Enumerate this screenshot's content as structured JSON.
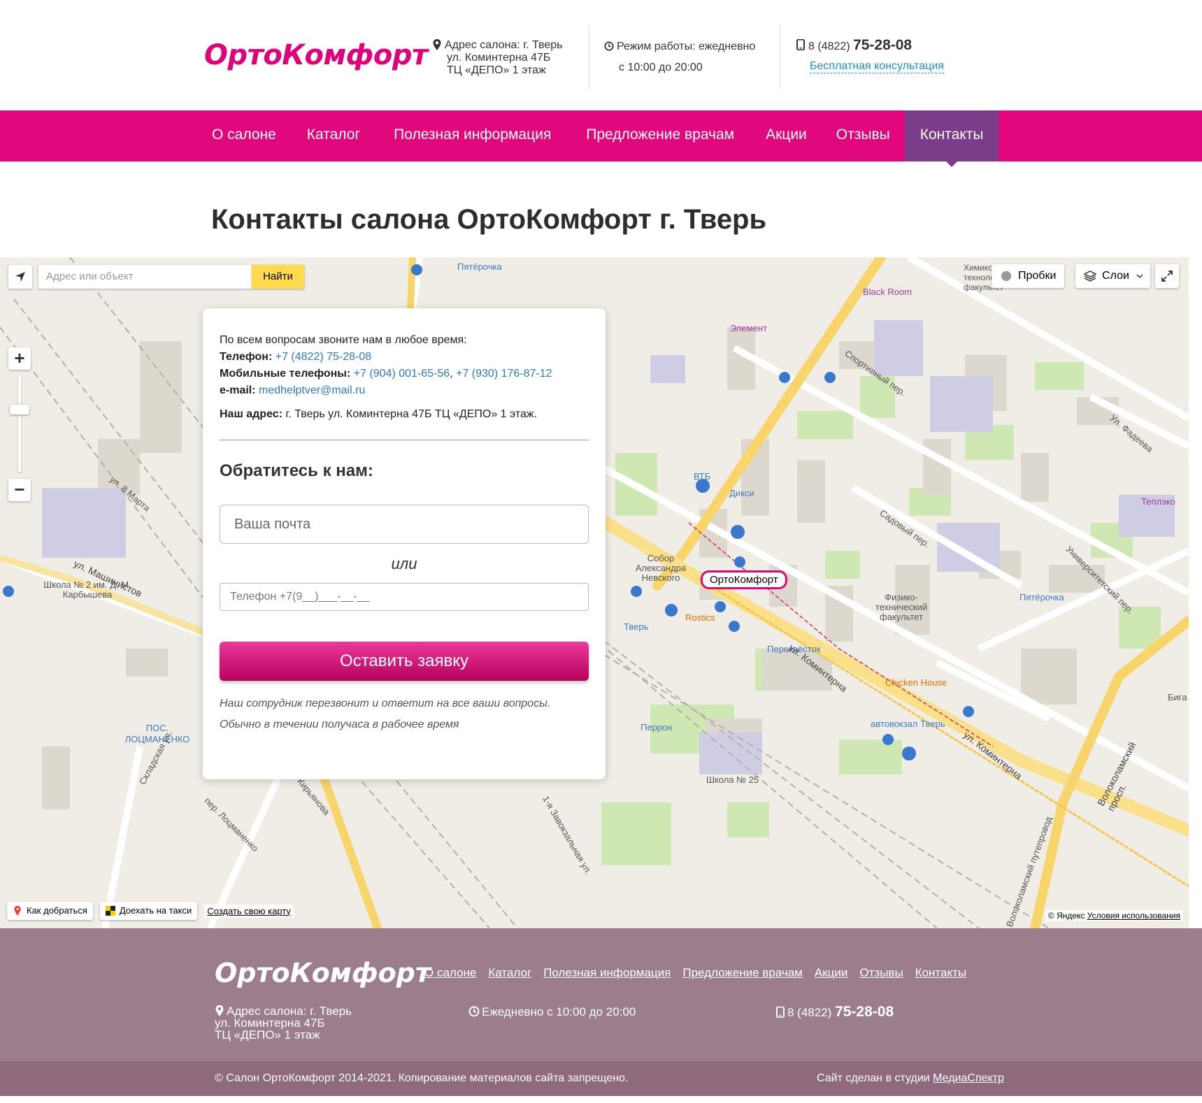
{
  "header": {
    "logo": "ОртоКомфорт",
    "address_line1": "Адрес салона: г. Тверь",
    "address_line2": "ул. Коминтерна 47Б",
    "address_line3": "ТЦ «ДЕПО» 1 этаж",
    "hours_line1": "Режим работы: ежедневно",
    "hours_line2": "с 10:00 до 20:00",
    "phone_prefix": "8 (4822)",
    "phone_number": "75-28-08",
    "consult_link": "Бесплатная консультация"
  },
  "nav": {
    "items": [
      {
        "label": "О салоне"
      },
      {
        "label": "Каталог"
      },
      {
        "label": "Полезная информация"
      },
      {
        "label": "Предложение врачам"
      },
      {
        "label": "Акции"
      },
      {
        "label": "Отзывы"
      },
      {
        "label": "Контакты"
      }
    ],
    "active": "Контакты"
  },
  "page_title": "Контакты салона ОртоКомфорт г. Тверь",
  "map": {
    "search_placeholder": "Адрес или объект",
    "search_button": "Найти",
    "traffic_button": "Пробки",
    "layers_button": "Слои",
    "marker_label": "ОртоКомфорт",
    "route_button": "Как добраться",
    "taxi_button": "Доехать на такси",
    "create_map_link": "Создать свою карту",
    "copyright": "© Яндекс",
    "terms_link": "Условия использования",
    "labels": {
      "pyaterochka1": "Пятёрочка",
      "pyaterochka2": "Пятёрочка",
      "black_room": "Black Room",
      "element": "Элемент",
      "vtb": "ВТБ",
      "diksi": "Дикси",
      "sobor": "Собор Александра Невского",
      "rostics": "Rostics",
      "tver_station": "Тверь",
      "perekrestok": "Перекрёсток",
      "chicken_house": "Chicken House",
      "avtovokzal": "автовокзал Тверь",
      "perron": "Перрон",
      "school25": "Школа № 25",
      "school2": "Школа № 2 им. Д. М. Карбышева",
      "locmanenko": "ПОС. ЛОЦМАНЕНКО",
      "fiztech": "Физико-технический факультет",
      "teplako": "Теплэко",
      "biga": "Бига",
      "khim_fak": "Химико-технологический факультет",
      "ul_kominterna1": "ул. Коминтерна",
      "ul_kominterna2": "ул. Коминтерна",
      "ul_mashinistov": "ул. Машинистов",
      "volokolamsky": "Волоколамский просп.",
      "sportivny": "Спортивный пер.",
      "sadovy": "Садовый пер.",
      "universitetsky": "Университетский пер.",
      "ul_fadeeva": "Ул. Фадеева",
      "ul_8marta": "ул. 8 Марта",
      "skladskaya": "Складская ул.",
      "locmanenko_per": "пер. Лоцманенко",
      "kiryanova": "ул. Кирьянова",
      "zavokzalnaya": "1-я Завокзальная ул.",
      "puteprovod": "Волоколамский путепровод"
    }
  },
  "contact_card": {
    "intro": "По всем вопросам звоните нам в любое время:",
    "phone_label": "Телефон:",
    "phone_value": "+7 (4822) 75-28-08",
    "mobile_label": "Мобильные телефоны:",
    "mobile_value1": "+7 (904) 001-65-56",
    "mobile_sep": ",",
    "mobile_value2": "+7 (930) 176-87-12",
    "email_label": "e-mail:",
    "email_value": "medhelptver@mail.ru",
    "address_label": "Наш адрес:",
    "address_value": "г. Тверь ул. Коминтерна 47Б ТЦ «ДЕПО» 1 этаж.",
    "form_title": "Обратитесь к нам:",
    "email_placeholder": "Ваша почта",
    "or_text": "или",
    "phone_placeholder": "Телефон +7(9__)___-__-__",
    "submit_button": "Оставить заявку",
    "note_line1": "Наш сотрудник перезвонит и ответит на все ваши вопросы.",
    "note_line2": "Обычно в течении получаса в рабочее время"
  },
  "footer": {
    "logo": "ОртоКомфорт",
    "nav": [
      "О салоне",
      "Каталог",
      "Полезная информация",
      "Предложение врачам",
      "Акции",
      "Отзывы",
      "Контакты"
    ],
    "address_line1": "Адрес салона: г. Тверь",
    "address_line2": "ул. Коминтерна 47Б",
    "address_line3": "ТЦ «ДЕПО» 1 этаж",
    "hours": "Ежедневно с 10:00 до 20:00",
    "phone_prefix": "8 (4822)",
    "phone_number": "75-28-08",
    "copyright": "© Салон ОртоКомфорт 2014-2021. Копирование материалов сайта запрещено.",
    "studio_prefix": "Сайт сделан в студии",
    "studio_link": "МедиаСпектр"
  },
  "colors": {
    "brand_pink": "#e0087c",
    "nav_active": "#7b3d8a",
    "footer_bg": "#9c7d8c",
    "footer_bottom": "#8e6a7c",
    "link_blue": "#2a7bc4",
    "search_button": "#ffdb4d"
  }
}
